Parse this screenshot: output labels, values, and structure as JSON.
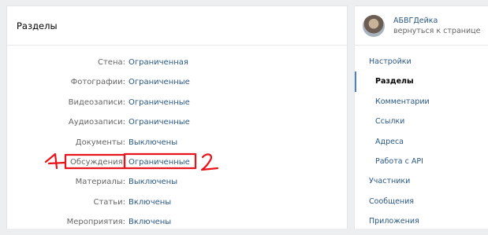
{
  "main": {
    "title": "Разделы",
    "rows": [
      {
        "label": "Стена:",
        "value": "Ограниченная"
      },
      {
        "label": "Фотографии:",
        "value": "Ограниченные"
      },
      {
        "label": "Видеозаписи:",
        "value": "Ограниченные"
      },
      {
        "label": "Аудиозаписи:",
        "value": "Ограниченные"
      },
      {
        "label": "Документы:",
        "value": "Выключены"
      },
      {
        "label": "Обсуждения:",
        "value": "Ограниченные"
      },
      {
        "label": "Материалы:",
        "value": "Выключены"
      },
      {
        "label": "Статьи:",
        "value": "Включены"
      },
      {
        "label": "Мероприятия:",
        "value": "Включены"
      }
    ]
  },
  "sidebar": {
    "profile_name": "АБВГДейка",
    "profile_back": "вернуться к странице",
    "items": [
      {
        "label": "Настройки",
        "level": "top"
      },
      {
        "label": "Разделы",
        "level": "active"
      },
      {
        "label": "Комментарии",
        "level": "sub"
      },
      {
        "label": "Ссылки",
        "level": "sub"
      },
      {
        "label": "Адреса",
        "level": "sub"
      },
      {
        "label": "Работа с API",
        "level": "sub"
      },
      {
        "label": "Участники",
        "level": "top"
      },
      {
        "label": "Сообщения",
        "level": "top"
      },
      {
        "label": "Приложения",
        "level": "top"
      }
    ]
  },
  "annotations": {
    "mark_1": "1",
    "mark_2": "2",
    "color": "#e8141b"
  }
}
